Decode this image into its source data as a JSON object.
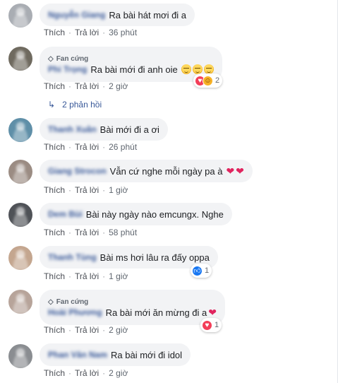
{
  "actions": {
    "like": "Thích",
    "reply": "Trả lời",
    "separator": "·"
  },
  "badge": {
    "label": "Fan cứng",
    "icon": "diamond-icon"
  },
  "comments": [
    {
      "author": "Nguyễn Giang",
      "text": "Ra bài hát mơi đi a",
      "time": "36 phút"
    },
    {
      "author": "Phi Trọng",
      "text": "Ra bài mới đi anh oie",
      "time": "2 giờ",
      "reaction_count": "2"
    },
    {
      "author": "Thanh Xuân",
      "text": "Bài mới đi a ơi",
      "time": "26 phút"
    },
    {
      "author": "Giang Strocon",
      "text": "Vẫn cứ nghe mỗi ngày pa à",
      "time": "1 giờ"
    },
    {
      "author": "Dem Bùi",
      "text": "Bài này ngày nào emcungx. Nghe",
      "time": "58 phút"
    },
    {
      "author": "Thanh Tùng",
      "text": "Bài ms hơi lâu ra đấy oppa",
      "time": "1 giờ",
      "reaction_count": "1"
    },
    {
      "author": "Hoài Phương",
      "text": "Ra bài mới ăn mừng đi a",
      "time": "2 giờ",
      "reaction_count": "1"
    },
    {
      "author": "Phan Văn Nam",
      "text": "Ra bài mới đi idol",
      "time": "2 giờ"
    }
  ],
  "replies_link": {
    "label": "2 phản hồi",
    "icon": "reply-arrow-icon"
  },
  "colors": {
    "link": "#385898",
    "bubble": "#f2f3f5",
    "love": "#f33e58",
    "like": "#1877f2"
  }
}
